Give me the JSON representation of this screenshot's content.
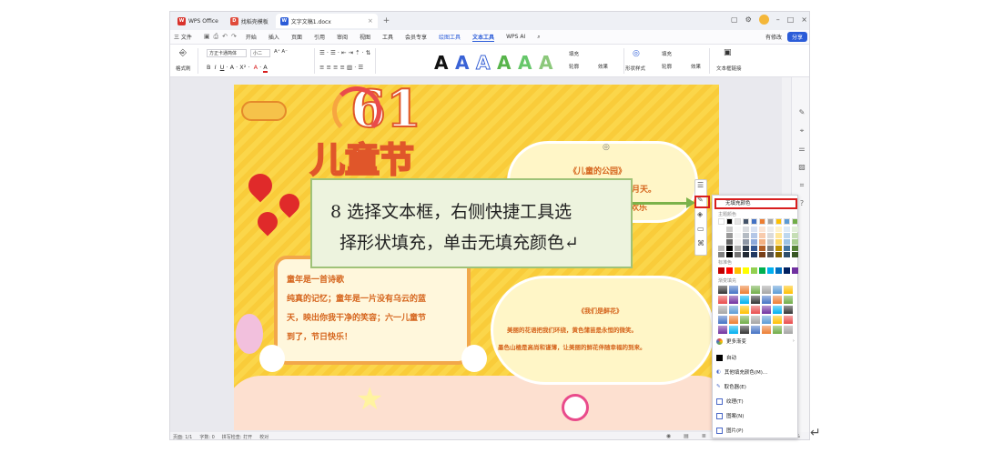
{
  "titlebar": {
    "tabs": [
      {
        "label": "WPS Office",
        "color": "#d9322b"
      },
      {
        "label": "找稻壳模板",
        "color": "#e04a3a"
      },
      {
        "label": "文字文稿1.docx",
        "color": "#2b5cd8"
      }
    ],
    "plus": "+"
  },
  "menubar": {
    "file": "三 文件",
    "items": [
      "开始",
      "插入",
      "页面",
      "引用",
      "审阅",
      "视图",
      "工具",
      "会员专享",
      "绘图工具",
      "文本工具",
      "WPS AI"
    ],
    "right": {
      "edit": "有修改",
      "share": "分享"
    }
  },
  "ribbon": {
    "format_painter": "格式刷",
    "font_name": "方正卡通简体",
    "font_size": "小二",
    "fill": "填充",
    "outline": "轮廓",
    "effect": "效果",
    "shape_fill": "填充",
    "shape_outline": "轮廓",
    "shape_effect": "效果",
    "shape_effect_label": "形状样式",
    "textbox_link": "文本框链接"
  },
  "poster": {
    "number": "61",
    "title": "儿童节",
    "park_title": "《儿童的公园》",
    "park_line1": "天真快乐的童年，我们度过六月天。",
    "park_line2": "大家游戏欢乐",
    "childhood_line1": "童年是一首诗歌",
    "childhood_line2": "纯真的记忆；童年是一片没有乌云的蓝",
    "childhood_line3": "天，映出你我干净的笑容；六一儿童节",
    "childhood_line4": "到了，节日快乐！",
    "flower_title": "《我们是鲜花》",
    "flower_line1": "美丽的花语把我们环绕，黄色蒲苗是永恒的微笑。",
    "flower_line2": "墨色山楂是高尚和谨薄，让美丽的鲜花伴随幸福的到来。"
  },
  "callout": {
    "line1": "8 选择文本框，右侧快捷工具选",
    "line2": "择形状填充，单击无填充颜色↵"
  },
  "popup": {
    "no_fill": "无填充颜色",
    "theme_colors": "主题颜色",
    "standard_colors": "标准色",
    "gradient_fill": "渐变填充",
    "more_gradient": "更多渐变",
    "auto": "自动",
    "other_fill": "其他填充颜色(M)...",
    "eyedropper": "取色器(E)",
    "texture": "纹理(T)",
    "pattern": "图案(N)",
    "picture": "图片(P)"
  },
  "statusbar": {
    "page": "页面: 1/1",
    "words": "字数: 0",
    "spell": "拼写检查: 打开",
    "proof": "校对",
    "zoom": "100%"
  },
  "colors": {
    "theme_row": [
      "#ffffff",
      "#000000",
      "#e7e6e6",
      "#44546a",
      "#4472c4",
      "#ed7d31",
      "#a5a5a5",
      "#ffc000",
      "#5b9bd5",
      "#70ad47"
    ],
    "standard_row": [
      "#c00000",
      "#ff0000",
      "#ffc000",
      "#ffff00",
      "#92d050",
      "#00b050",
      "#00b0f0",
      "#0070c0",
      "#002060",
      "#7030a0"
    ]
  }
}
